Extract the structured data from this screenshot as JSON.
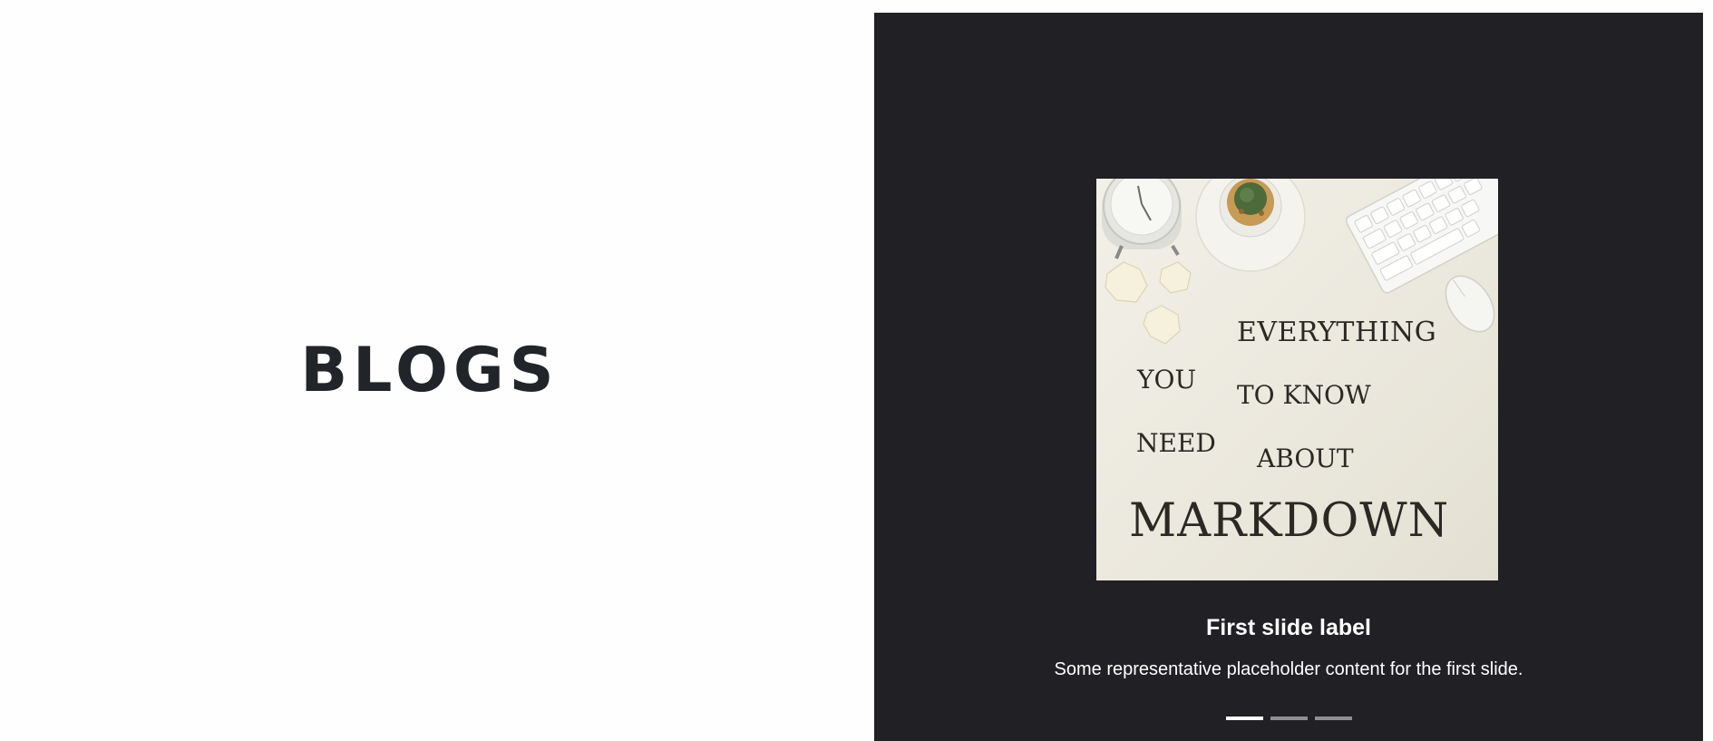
{
  "page": {
    "heading": "BLOGS"
  },
  "carousel": {
    "image": {
      "lines": [
        "EVERYTHING",
        "YOU",
        "TO KNOW",
        "NEED",
        "ABOUT",
        "MARKDOWN"
      ]
    },
    "slides": [
      {
        "title": "First slide label",
        "text": "Some representative placeholder content for the first slide."
      }
    ],
    "active_index": 0,
    "indicator_count": 3
  },
  "colors": {
    "heading_text": "#212529",
    "carousel_background": "#212024",
    "caption_text": "#ffffff",
    "image_background": "#efede4"
  }
}
